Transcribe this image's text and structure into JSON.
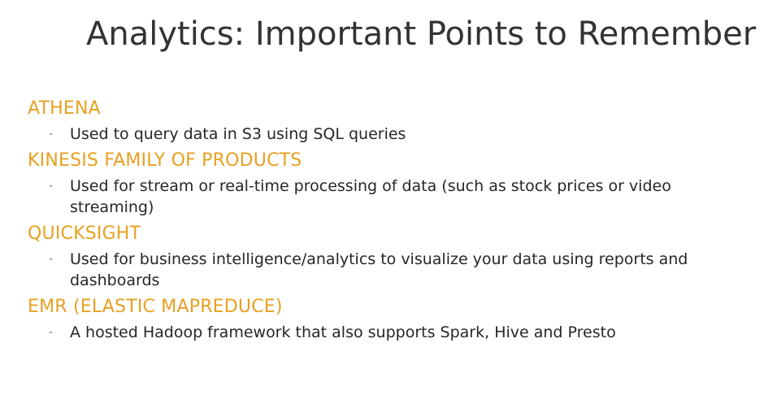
{
  "title": "Analytics: Important Points to Remember",
  "sections": [
    {
      "heading": "ATHENA",
      "bullet": "Used to query data in S3 using SQL queries"
    },
    {
      "heading": "KINESIS FAMILY OF PRODUCTS",
      "bullet": "Used for stream or real-time processing of data (such as stock prices or video streaming)"
    },
    {
      "heading": "QUICKSIGHT",
      "bullet": "Used for business intelligence/analytics to visualize your data using reports and dashboards"
    },
    {
      "heading": "EMR (ELASTIC MAPREDUCE)",
      "bullet": "A hosted Hadoop framework that also supports Spark, Hive and Presto"
    }
  ],
  "bullet_marker": "-",
  "colors": {
    "heading": "#e8a022",
    "title": "#333333",
    "text": "#262626"
  }
}
